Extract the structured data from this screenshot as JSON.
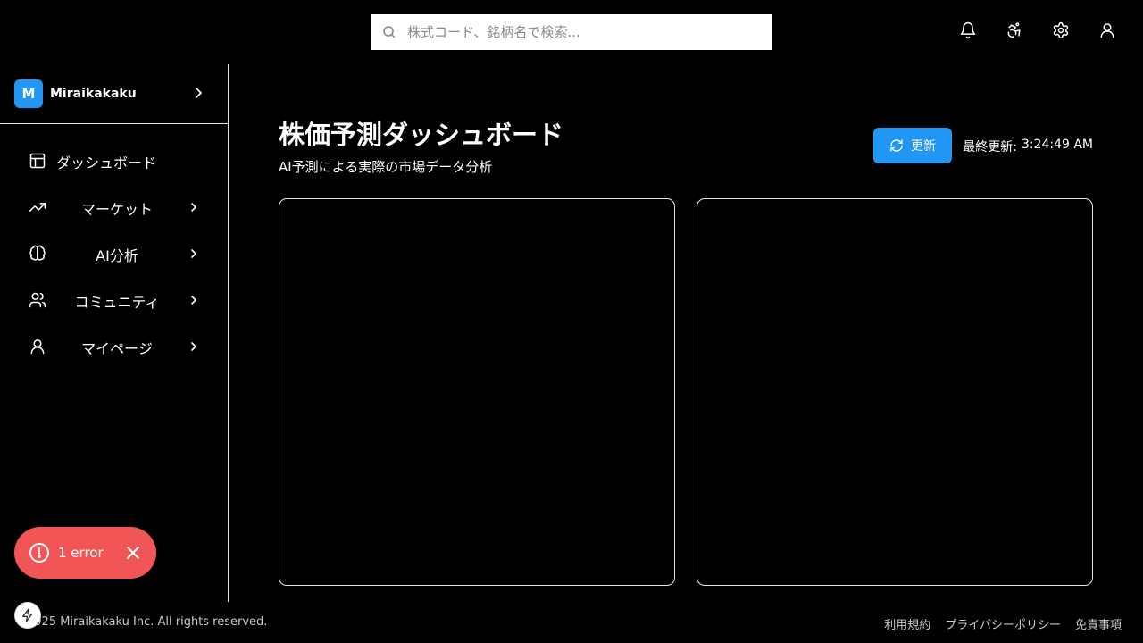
{
  "header": {
    "search": {
      "placeholder": "株式コード、銘柄名で検索...",
      "value": ""
    },
    "icons": [
      "bell-icon",
      "accessibility-icon",
      "gear-icon",
      "user-icon"
    ]
  },
  "sidebar": {
    "org": {
      "initial": "M",
      "name": "Miraikakaku"
    },
    "items": [
      {
        "label": "ダッシュボード",
        "icon": "dashboard-icon",
        "has_submenu": false
      },
      {
        "label": "マーケット",
        "icon": "trending-up-icon",
        "has_submenu": true
      },
      {
        "label": "AI分析",
        "icon": "brain-icon",
        "has_submenu": true
      },
      {
        "label": "コミュニティ",
        "icon": "users-icon",
        "has_submenu": true
      },
      {
        "label": "マイページ",
        "icon": "user-icon",
        "has_submenu": true
      }
    ]
  },
  "main": {
    "title": "株価予測ダッシュボード",
    "subtitle": "AI予測による実際の市場データ分析",
    "refresh_label": "更新",
    "last_updated_label": "最終更新:",
    "last_updated_time": "3:24:49 AM"
  },
  "footer": {
    "copyright": "2025 Miraikakaku Inc. All rights reserved.",
    "links": [
      "利用規約",
      "プライバシーポリシー",
      "免責事項"
    ]
  },
  "error_toast": {
    "text": "1 error"
  },
  "colors": {
    "accent": "#2196f3",
    "error": "#f25555",
    "background": "#000000",
    "border": "#e5e5e5"
  }
}
